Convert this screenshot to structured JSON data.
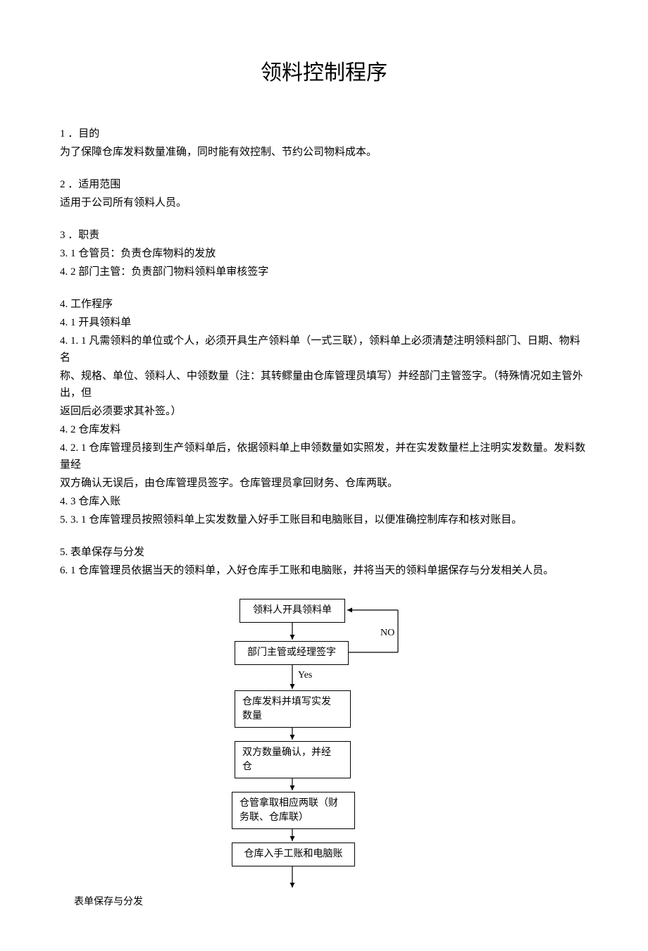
{
  "title": "领料控制程序",
  "sections": {
    "s1_head": "1 ．目的",
    "s1_body": "为了保障仓库发料数量准确，同时能有效控制、节约公司物料成本。",
    "s2_head": "2 ．适用范围",
    "s2_body": "适用于公司所有领料人员。",
    "s3_head": "3 ．职责",
    "s3_1": "3.  1 仓管员：负责仓库物料的发放",
    "s3_2": "4.  2 部门主管：负责部门物料领料单审核签字",
    "s4_head": "4. 工作程序",
    "s4_1": "4.  1 开具领料单",
    "s4_11a": "4.  1. 1 凡需领料的单位或个人，必须开具生产领料单（一式三联），领料单上必须清楚注明领料部门、日期、物料名",
    "s4_11b": "称、规格、单位、领料人、中领数量（注：其转鳏量由仓库管理员填写）并经部门主管签字。（特殊情况如主管外出，但",
    "s4_11c": "返回后必须要求其补签。）",
    "s4_2": "4.  2 仓库发料",
    "s4_21a": "4.  2. 1 仓库管理员接到生产领料单后，依据领料单上申领数量如实照发，并在实发数量栏上注明实发数量。发料数量经",
    "s4_21b": "双方确认无误后，由仓库管理员签字。仓库管理员拿回财务、仓库两联。",
    "s4_3": "4.  3 仓库入账",
    "s4_31": "5.  3. 1 仓库管理员按照领料单上实发数量入好手工账目和电脑账目，以便准确控制库存和核对账目。",
    "s5_head": "5. 表单保存与分发",
    "s5_1": "6.  1 仓库管理员依据当天的领料单，入好仓库手工账和电脑账，并将当天的领料单据保存与分发相关人员。"
  },
  "flow": {
    "b1": "领料人开具领料单",
    "b2": "部门主管或经理签字",
    "b3a": "仓库发料并填写实发",
    "b3b": "数量",
    "b4a": "双方数量确认，并经",
    "b4b": "仓",
    "b5a": "仓管拿取相应两联（财",
    "b5b": "务联、仓库联）",
    "b6": "仓库入手工账和电脑账",
    "yes": "Yes",
    "no": "NO",
    "caption": "表单保存与分发"
  }
}
